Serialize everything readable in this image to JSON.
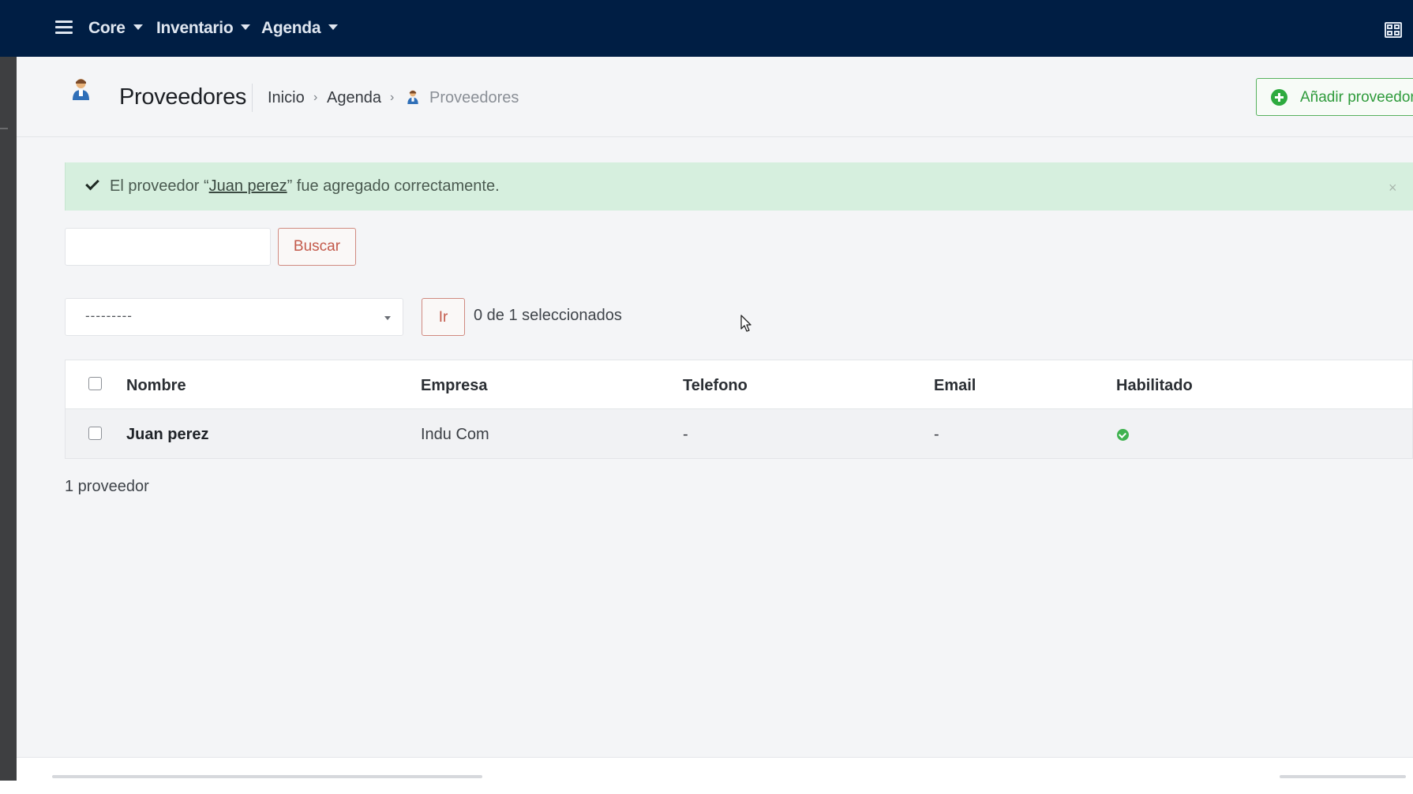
{
  "nav": {
    "menus": [
      {
        "label": "Core"
      },
      {
        "label": "Inventario"
      },
      {
        "label": "Agenda"
      }
    ]
  },
  "header": {
    "title": "Proveedores",
    "breadcrumb": [
      "Inicio",
      "Agenda",
      "Proveedores"
    ],
    "add_button": "Añadir proveedor"
  },
  "alert": {
    "prefix": "El proveedor “",
    "link": "Juan perez",
    "suffix": "” fue agregado correctamente.",
    "close": "×"
  },
  "search": {
    "value": "",
    "button": "Buscar"
  },
  "actions": {
    "selected_value": "---------",
    "go_button": "Ir",
    "selection_count": "0 de 1 seleccionados"
  },
  "table": {
    "columns": [
      "Nombre",
      "Empresa",
      "Telefono",
      "Email",
      "Habilitado"
    ],
    "rows": [
      {
        "nombre": "Juan perez",
        "empresa": "Indu Com",
        "telefono": "-",
        "email": "-",
        "habilitado": true
      }
    ]
  },
  "total": "1 proveedor",
  "colors": {
    "navbar": "#001e44",
    "success": "#3fb24f",
    "danger_outline": "#c35a4b",
    "alert_bg": "#d6efde"
  }
}
